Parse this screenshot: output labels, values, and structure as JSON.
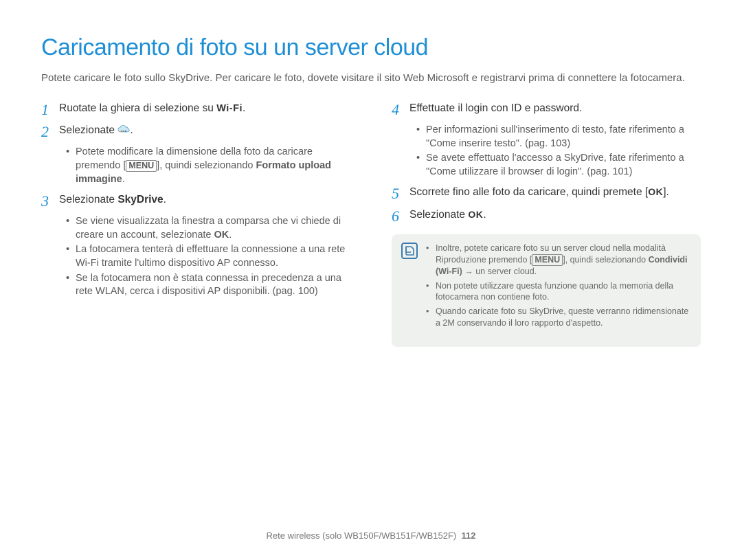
{
  "title": "Caricamento di foto su un server cloud",
  "intro": "Potete caricare le foto sullo SkyDrive. Per caricare le foto, dovete visitare il sito Web Microsoft e registrarvi prima di connettere la fotocamera.",
  "left": {
    "step1": {
      "num": "1",
      "text_before": "Ruotate la ghiera di selezione su ",
      "wifi": "Wi-Fi",
      "text_after": "."
    },
    "step2": {
      "num": "2",
      "text_before": "Selezionate ",
      "text_after": "."
    },
    "step2_bullets": {
      "b1_a": "Potete modificare la dimensione della foto da caricare premendo [",
      "b1_menu": "MENU",
      "b1_b": "], quindi selezionando ",
      "b1_bold": "Formato upload immagine",
      "b1_c": "."
    },
    "step3": {
      "num": "3",
      "text_before": "Selezionate ",
      "bold": "SkyDrive",
      "text_after": "."
    },
    "step3_bullets": {
      "b1": "Se viene visualizzata la finestra a comparsa che vi chiede di creare un account, selezionate ",
      "b1_bold": "OK",
      "b1_after": ".",
      "b2": "La fotocamera tenterà di effettuare la connessione a una rete Wi-Fi tramite l'ultimo dispositivo AP connesso.",
      "b3": "Se la fotocamera non è stata connessa in precedenza a una rete WLAN, cerca i dispositivi AP disponibili. (pag. 100)"
    }
  },
  "right": {
    "step4": {
      "num": "4",
      "text": "Effettuate il login con ID e password."
    },
    "step4_bullets": {
      "b1": "Per informazioni sull'inserimento di testo, fate riferimento a \"Come inserire testo\". (pag. 103)",
      "b2": "Se avete effettuato l'accesso a SkyDrive, fate riferimento a \"Come utilizzare il browser di login\". (pag. 101)"
    },
    "step5": {
      "num": "5",
      "text_before": "Scorrete fino alle foto da caricare, quindi premete [",
      "ok": "OK",
      "text_after": "]."
    },
    "step6": {
      "num": "6",
      "text_before": "Selezionate ",
      "ok": "OK",
      "text_after": "."
    },
    "note": {
      "n1_a": "Inoltre, potete caricare foto su un server cloud nella modalità Riproduzione premendo [",
      "n1_menu": "MENU",
      "n1_b": "], quindi selezionando ",
      "n1_bold": "Condividi (Wi-Fi)",
      "n1_arrow": " → ",
      "n1_c": "un server cloud.",
      "n2": "Non potete utilizzare questa funzione quando la memoria della fotocamera non contiene foto.",
      "n3": "Quando caricate foto su SkyDrive, queste verranno ridimensionate a 2M conservando il loro rapporto d'aspetto."
    }
  },
  "footer": {
    "text": "Rete wireless (solo WB150F/WB151F/WB152F)",
    "page": "112"
  }
}
